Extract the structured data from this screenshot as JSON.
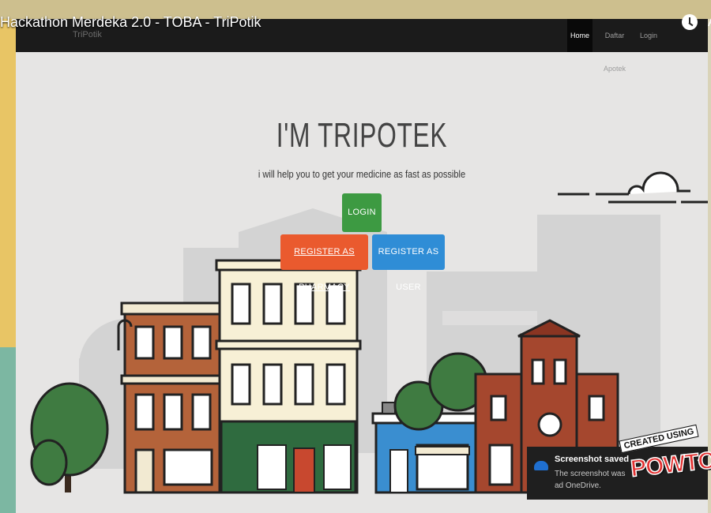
{
  "video": {
    "title": "Hackathon Merdeka 2.0 - TOBA - TriPotik",
    "title_cut": "A"
  },
  "site": {
    "brand": "TriPotik",
    "nav": {
      "home": "Home",
      "apotek": "Daftar Apotek",
      "login": "Login"
    },
    "hero_title": "I'M TRIPOTEK",
    "hero_subtitle": "i will help you to get your medicine as fast as possible",
    "buttons": {
      "login": "LOGIN",
      "register_pharmacy": "REGISTER AS PHARMACY",
      "register_user": "REGISTER AS USER"
    }
  },
  "toast": {
    "title": "Screenshot saved",
    "body": "The screenshot was ad OneDrive.",
    "close": "✕"
  },
  "watermark": {
    "created_using": "CREATED USING",
    "logo": "POWTOON"
  },
  "colors": {
    "login_button": "#3d9a42",
    "pharmacy_button": "#ea5a2e",
    "user_button": "#2f8dd6",
    "navbar": "#1b1b1b"
  },
  "icons": [
    "clock-icon",
    "onedrive-icon",
    "close-icon"
  ]
}
